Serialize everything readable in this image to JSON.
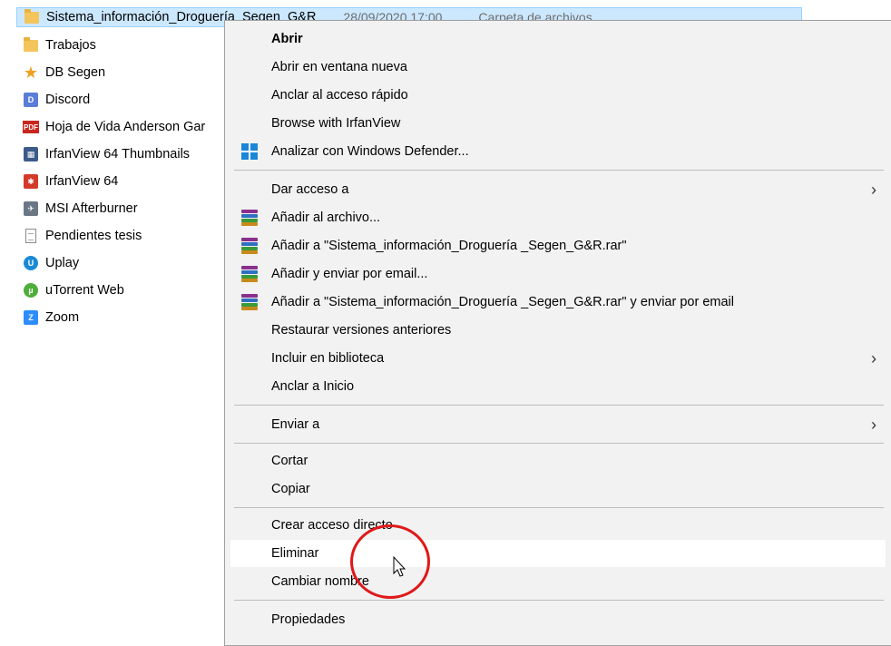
{
  "files": [
    {
      "name": "Sistema_información_Droguería_Segen_G&R",
      "date": "28/09/2020 17:00",
      "type": "Carpeta de archivos",
      "icon": "folder-icon",
      "selected": true
    },
    {
      "name": "Trabajos",
      "icon": "folder-icon"
    },
    {
      "name": "DB Segen",
      "icon": "star-icon"
    },
    {
      "name": "Discord",
      "icon": "discord-shortcut-icon"
    },
    {
      "name": "Hoja de Vida Anderson Gar",
      "icon": "pdf-icon"
    },
    {
      "name": "IrfanView 64 Thumbnails",
      "icon": "irfanview-thumbnails-icon"
    },
    {
      "name": "IrfanView 64",
      "icon": "irfanview-icon"
    },
    {
      "name": "MSI Afterburner",
      "icon": "msi-afterburner-icon"
    },
    {
      "name": "Pendientes tesis",
      "icon": "text-document-icon"
    },
    {
      "name": "Uplay",
      "icon": "uplay-icon"
    },
    {
      "name": "uTorrent Web",
      "icon": "utorrent-icon"
    },
    {
      "name": "Zoom",
      "icon": "zoom-icon"
    }
  ],
  "menu": {
    "items": [
      {
        "label": "Abrir",
        "bold": true
      },
      {
        "label": "Abrir en ventana nueva"
      },
      {
        "label": "Anclar al acceso rápido"
      },
      {
        "label": "Browse with IrfanView"
      },
      {
        "label": "Analizar con Windows Defender...",
        "icon": "windows-defender-icon"
      },
      {
        "label": "Dar acceso a",
        "submenu": true
      },
      {
        "label": "Añadir al archivo...",
        "icon": "winrar-icon"
      },
      {
        "label": "Añadir a \"Sistema_información_Droguería _Segen_G&R.rar\"",
        "icon": "winrar-icon"
      },
      {
        "label": "Añadir y enviar por email...",
        "icon": "winrar-icon"
      },
      {
        "label": "Añadir a \"Sistema_información_Droguería _Segen_G&R.rar\" y enviar por email",
        "icon": "winrar-icon"
      },
      {
        "label": "Restaurar versiones anteriores"
      },
      {
        "label": "Incluir en biblioteca",
        "submenu": true
      },
      {
        "label": "Anclar a Inicio"
      },
      {
        "label": "Enviar a",
        "submenu": true
      },
      {
        "label": "Cortar"
      },
      {
        "label": "Copiar"
      },
      {
        "label": "Crear acceso directo"
      },
      {
        "label": "Eliminar",
        "hover": true
      },
      {
        "label": "Cambiar nombre"
      },
      {
        "label": "Propiedades"
      }
    ]
  },
  "colors": {
    "selection": "#cce8ff",
    "menu_bg": "#f2f2f2",
    "annotation": "#e01818"
  }
}
